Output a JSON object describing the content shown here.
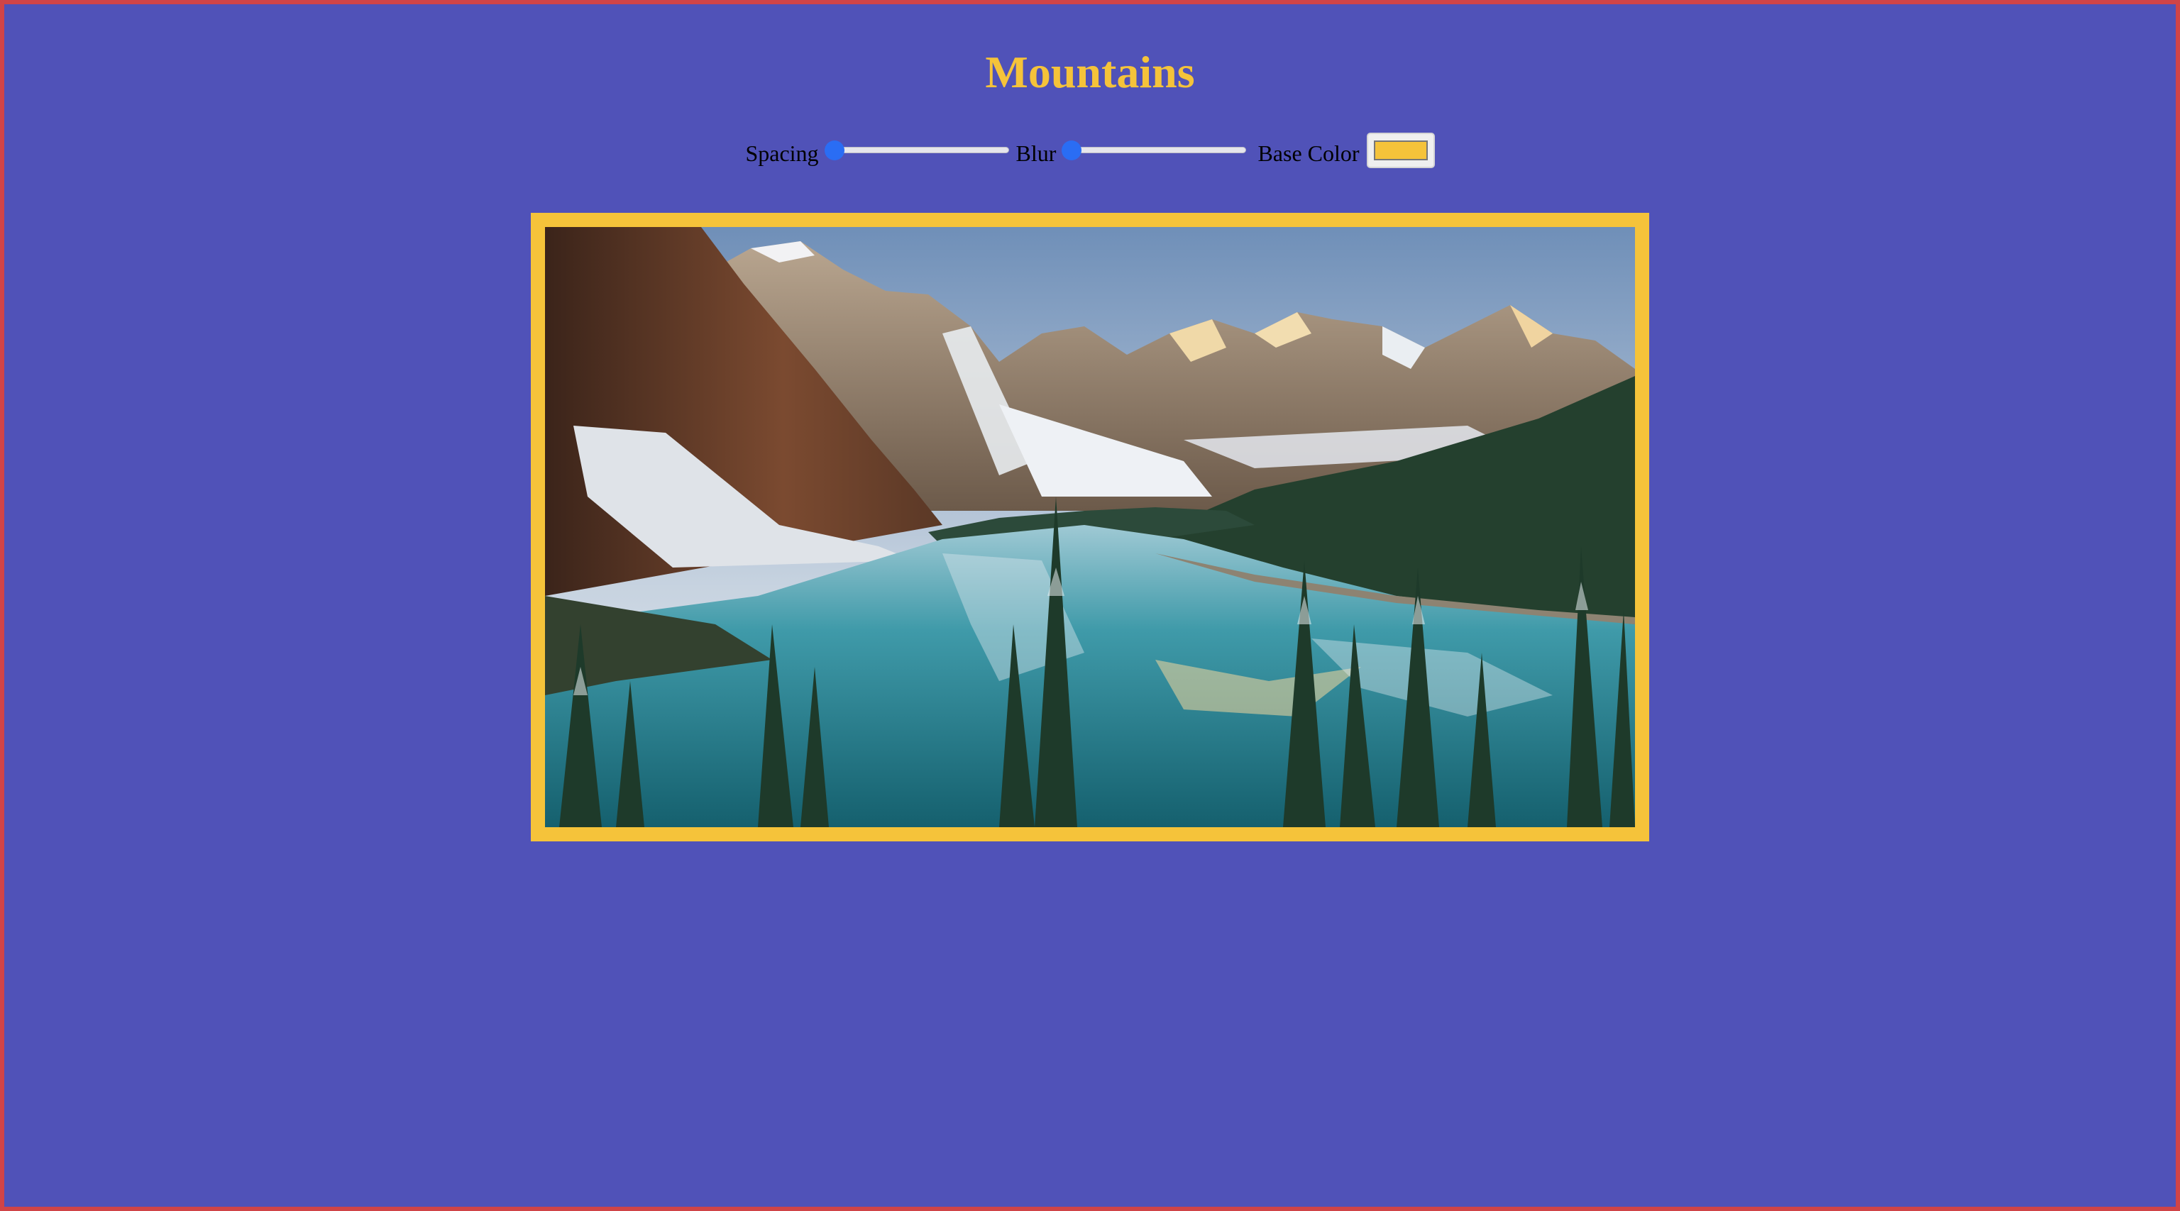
{
  "page": {
    "title": "Mountains"
  },
  "controls": {
    "spacing_label": "Spacing",
    "spacing_value": 0,
    "blur_label": "Blur",
    "blur_value": 0,
    "base_color_label": "Base Color",
    "base_color_value": "#f5c33a"
  },
  "colors": {
    "background": "#5052b8",
    "accent": "#f5c33a",
    "slider": "#2a6df4",
    "page_border": "#d04448"
  },
  "image": {
    "subject": "mountain-lake-landscape"
  }
}
